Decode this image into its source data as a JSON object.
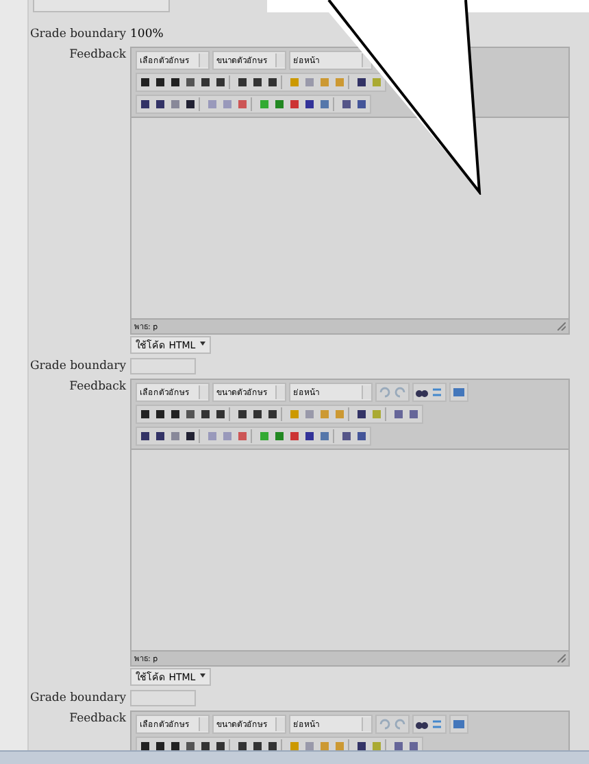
{
  "sections": [
    {
      "grade_label": "Grade boundary",
      "grade_value": "100%",
      "feedback_label": "Feedback",
      "editor": {
        "font_family": "เลือกตัวอักษร",
        "font_size": "ขนาดตัวอักษร",
        "format": "ย่อหน้า",
        "path": "พาธ: p",
        "mode": "ใช้โค้ด HTML"
      }
    },
    {
      "grade_label": "Grade boundary",
      "feedback_label": "Feedback",
      "editor": {
        "font_family": "เลือกตัวอักษร",
        "font_size": "ขนาดตัวอักษร",
        "format": "ย่อหน้า",
        "path": "พาธ: p",
        "mode": "ใช้โค้ด HTML"
      }
    },
    {
      "grade_label": "Grade boundary",
      "feedback_label": "Feedback",
      "editor": {
        "font_family": "เลือกตัวอักษร",
        "font_size": "ขนาดตัวอักษร",
        "format": "ย่อหน้า"
      }
    }
  ]
}
